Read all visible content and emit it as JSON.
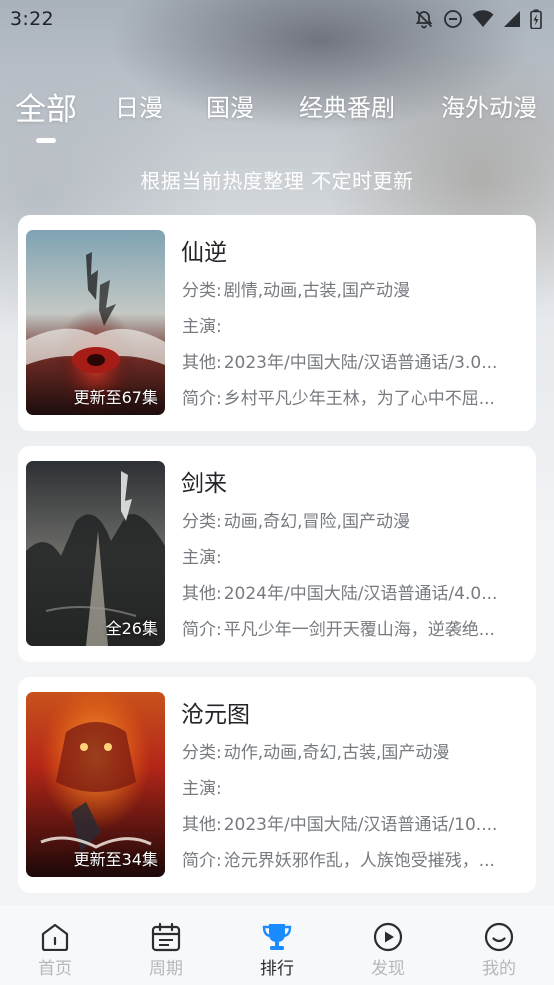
{
  "status_bar": {
    "time": "3:22",
    "icons": [
      "notifications-off-icon",
      "do-not-disturb-icon",
      "wifi-icon",
      "signal-icon",
      "battery-icon"
    ]
  },
  "tabs": [
    {
      "label": "全部",
      "active": true
    },
    {
      "label": "日漫",
      "active": false
    },
    {
      "label": "国漫",
      "active": false
    },
    {
      "label": "经典番剧",
      "active": false
    },
    {
      "label": "海外动漫",
      "active": false
    }
  ],
  "subtitle": "根据当前热度整理 不定时更新",
  "labels": {
    "category": "分类:",
    "cast": "主演:",
    "other": "其他:",
    "intro": "简介:"
  },
  "items": [
    {
      "title": "仙逆",
      "badge": "更新至67集",
      "category": "剧情,动画,古装,国产动漫",
      "cast": "",
      "other": "2023年/中国大陆/汉语普通话/3.0...",
      "intro": "乡村平凡少年王林，为了心中不屈..."
    },
    {
      "title": "剑来",
      "badge": "全26集",
      "category": "动画,奇幻,冒险,国产动漫",
      "cast": "",
      "other": "2024年/中国大陆/汉语普通话/4.0...",
      "intro": "平凡少年一剑开天覆山海，逆袭绝..."
    },
    {
      "title": "沧元图",
      "badge": "更新至34集",
      "category": "动作,动画,奇幻,古装,国产动漫",
      "cast": "",
      "other": "2023年/中国大陆/汉语普通话/10....",
      "intro": "沧元界妖邪作乱，人族饱受摧残，..."
    }
  ],
  "bottom_nav": [
    {
      "label": "首页",
      "icon": "home-icon",
      "active": false
    },
    {
      "label": "周期",
      "icon": "calendar-icon",
      "active": false
    },
    {
      "label": "排行",
      "icon": "trophy-icon",
      "active": true
    },
    {
      "label": "发现",
      "icon": "play-circle-icon",
      "active": false
    },
    {
      "label": "我的",
      "icon": "profile-smile-icon",
      "active": false
    }
  ],
  "colors": {
    "accent": "#1a8cff",
    "active_text": "#2a2d31",
    "inactive_text": "#b4b8bd"
  }
}
